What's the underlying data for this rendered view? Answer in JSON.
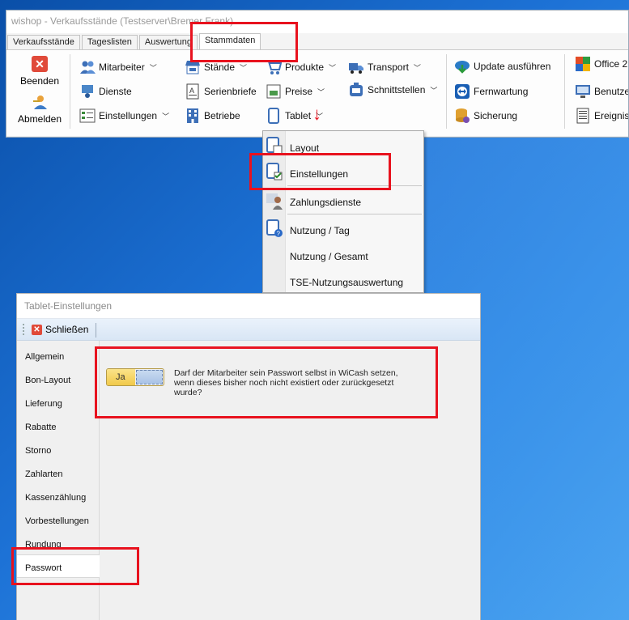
{
  "window": {
    "title": "wishop - Verkaufsstände (Testserver\\Bremer Frank)"
  },
  "tabs": [
    "Verkaufsstände",
    "Tageslisten",
    "Auswertung",
    "Stammdaten"
  ],
  "ribbon": {
    "beenden": "Beenden",
    "abmelden": "Abmelden",
    "mitarbeiter": "Mitarbeiter",
    "dienste": "Dienste",
    "einstellungen": "Einstellungen",
    "staende": "Stände",
    "serienbriefe": "Serienbriefe",
    "betriebe": "Betriebe",
    "produkte": "Produkte",
    "preise": "Preise",
    "tablet": "Tablet",
    "transport": "Transport",
    "schnittstellen": "Schnittstellen",
    "update": "Update ausführen",
    "fernwartung": "Fernwartung",
    "sicherung": "Sicherung",
    "office": "Office 2",
    "benutzer": "Benutzer",
    "ereignis": "Ereignisa"
  },
  "tablet_menu": {
    "items": [
      "Layout",
      "Einstellungen",
      "Zahlungsdienste",
      "Nutzung / Tag",
      "Nutzung / Gesamt",
      "TSE-Nutzungsauswertung"
    ]
  },
  "dialog": {
    "title": "Tablet-Einstellungen",
    "close_label": "Schließen",
    "nav": [
      "Allgemein",
      "Bon-Layout",
      "Lieferung",
      "Rabatte",
      "Storno",
      "Zahlarten",
      "Kassenzählung",
      "Vorbestellungen",
      "Rundung",
      "Passwort"
    ],
    "active_nav": "Passwort",
    "toggle_label": "Ja",
    "question": "Darf der Mitarbeiter sein Passwort selbst in WiCash setzen, wenn dieses bisher noch nicht existiert oder zurückgesetzt wurde?"
  },
  "colors": {
    "annotation_red": "#e8121e",
    "toggle_yellow": "#f1c94a",
    "desktop_blue": "#1d72d6"
  }
}
